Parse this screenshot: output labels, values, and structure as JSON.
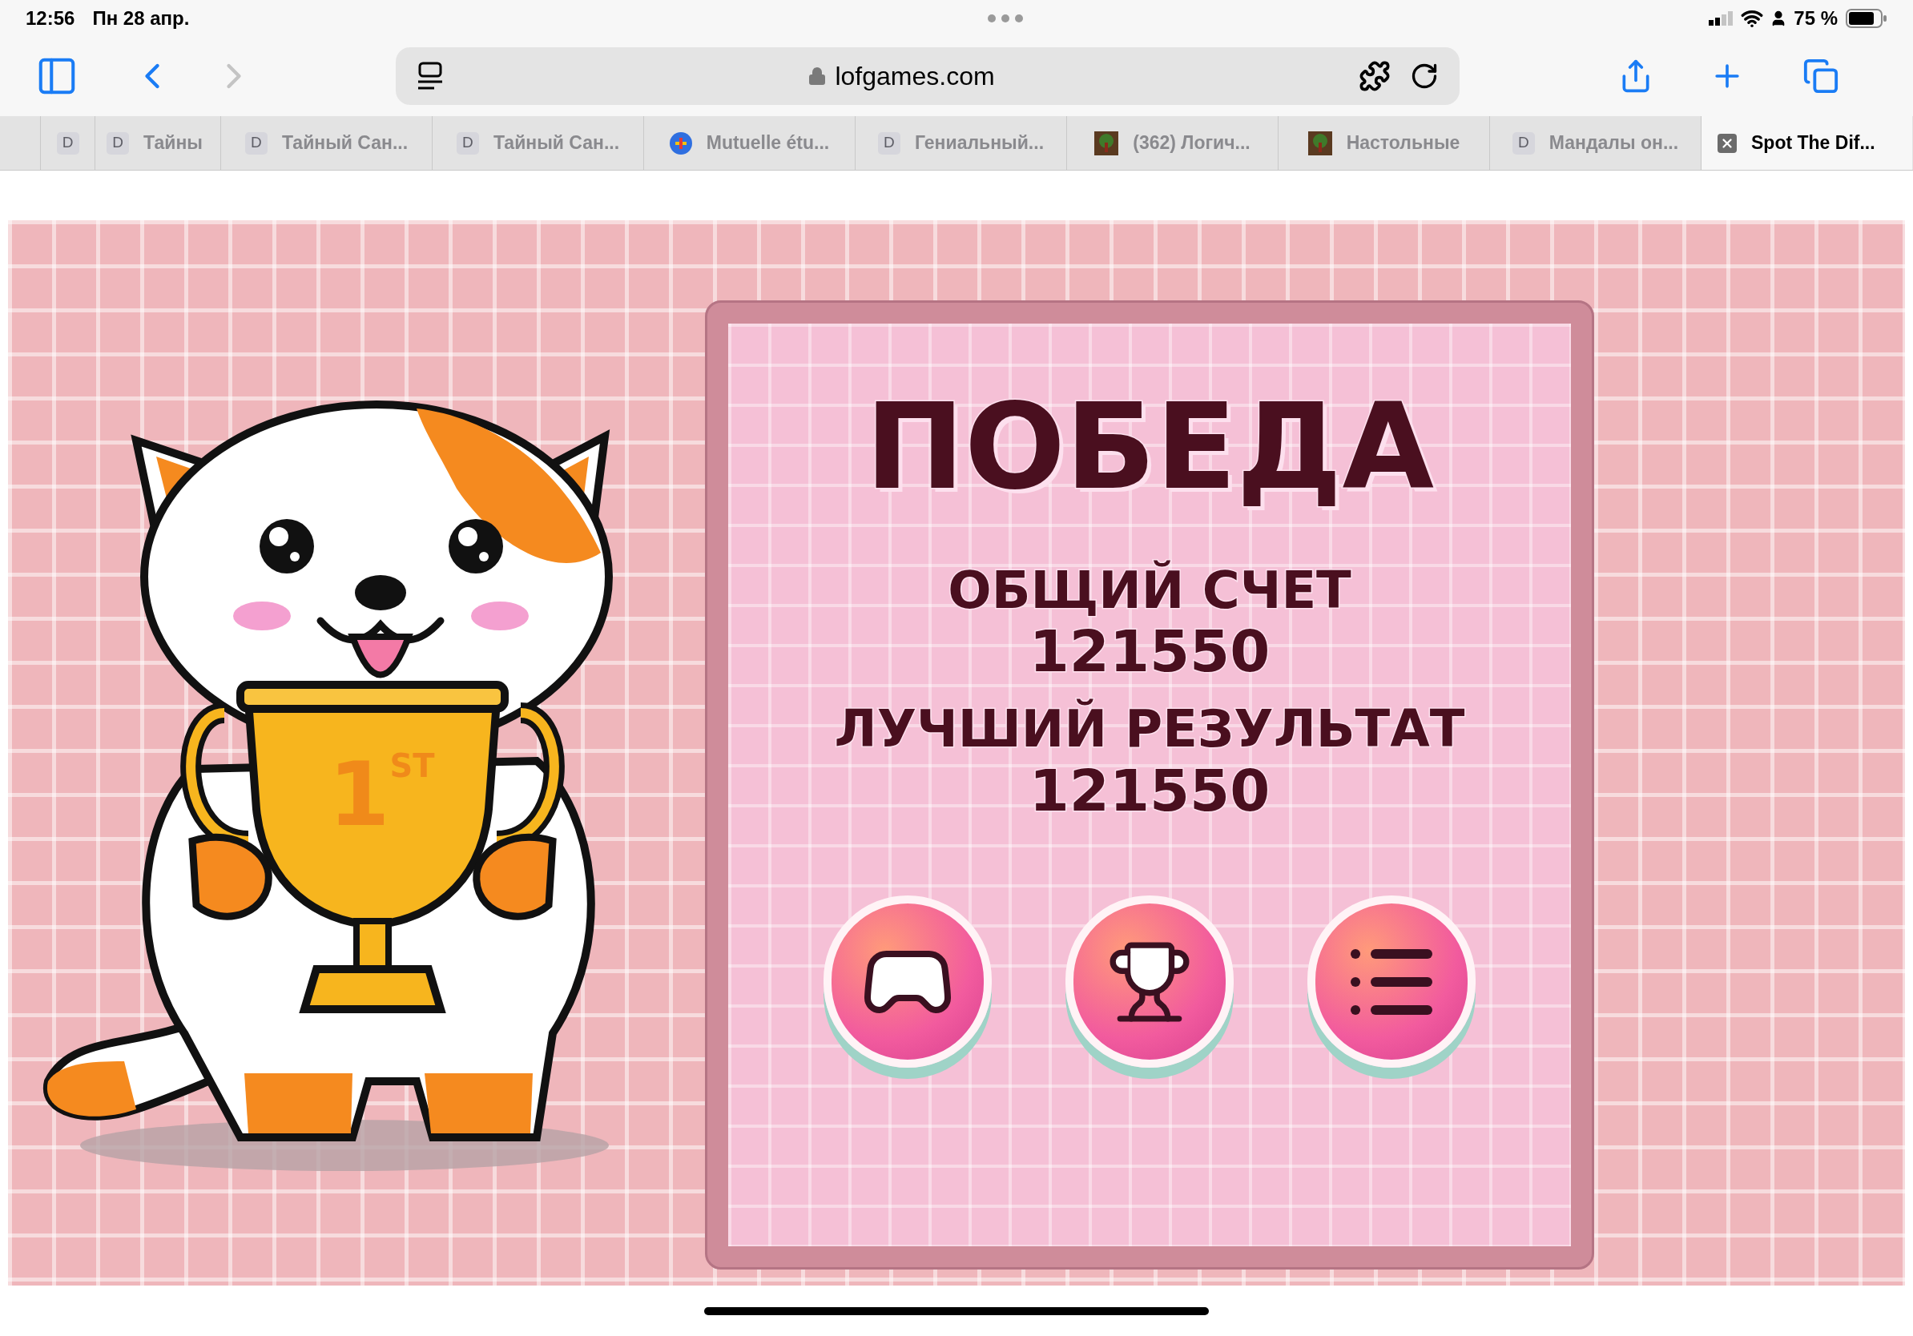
{
  "status_bar": {
    "time": "12:56",
    "date": "Пн 28 апр.",
    "battery_text": "75 %"
  },
  "toolbar": {
    "back_enabled": true,
    "forward_enabled": false,
    "address": "lofgames.com"
  },
  "tabs": [
    {
      "kind": "letter",
      "letter": "D",
      "selected": false
    },
    {
      "kind": "letter",
      "letter": "D",
      "title": "Тайны",
      "selected": false
    },
    {
      "kind": "letter",
      "letter": "D",
      "title": "Тайный Сан...",
      "selected": false
    },
    {
      "kind": "letter",
      "letter": "D",
      "title": "Тайный Сан...",
      "selected": false
    },
    {
      "kind": "logo",
      "title": "Mutuelle étu...",
      "selected": false
    },
    {
      "kind": "letter",
      "letter": "D",
      "title": "Гениальный...",
      "selected": false
    },
    {
      "kind": "image",
      "title": "(362) Логич...",
      "selected": false
    },
    {
      "kind": "image",
      "title": "Настольные",
      "selected": false
    },
    {
      "kind": "letter",
      "letter": "D",
      "title": "Мандалы он...",
      "selected": false
    },
    {
      "kind": "close",
      "title": "Spot The Dif...",
      "selected": true
    }
  ],
  "game": {
    "title": "ПОБЕДА",
    "stats": [
      {
        "label": "ОБЩИЙ СЧЕТ",
        "value": "121550"
      },
      {
        "label": "ЛУЧШИЙ РЕЗУЛЬТАТ",
        "value": "121550"
      }
    ],
    "trophy_rank": "1",
    "trophy_rank_suffix": "ST",
    "buttons": [
      {
        "kind": "play"
      },
      {
        "kind": "leaderboard"
      },
      {
        "kind": "menu"
      }
    ]
  }
}
